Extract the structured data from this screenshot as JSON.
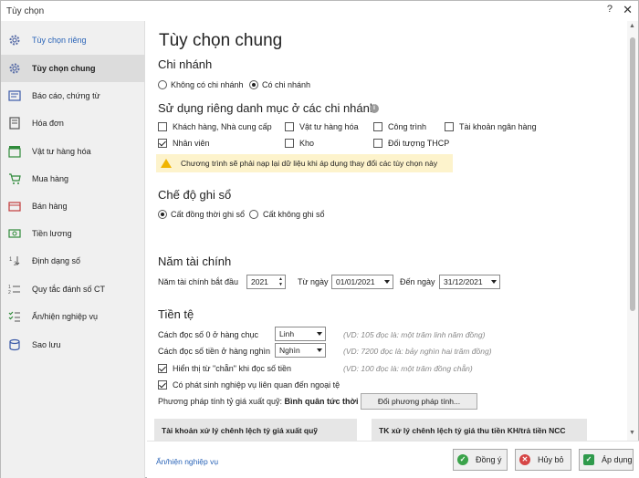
{
  "window": {
    "title": "Tùy chọn",
    "help": "?",
    "close": "✕"
  },
  "sidebar": {
    "items": [
      {
        "label": "Tùy chọn riêng",
        "icon": "gear-icon"
      },
      {
        "label": "Tùy chọn chung",
        "icon": "gear-icon"
      },
      {
        "label": "Báo cáo, chứng từ",
        "icon": "report-icon"
      },
      {
        "label": "Hóa đơn",
        "icon": "invoice-icon"
      },
      {
        "label": "Vật tư hàng hóa",
        "icon": "box-icon"
      },
      {
        "label": "Mua hàng",
        "icon": "cart-icon"
      },
      {
        "label": "Bán hàng",
        "icon": "sale-icon"
      },
      {
        "label": "Tiền lương",
        "icon": "money-icon"
      },
      {
        "label": "Định dạng số",
        "icon": "number-format-icon"
      },
      {
        "label": "Quy tắc đánh số CT",
        "icon": "numbering-icon"
      },
      {
        "label": "Ẩn/hiện nghiệp vụ",
        "icon": "checklist-icon"
      },
      {
        "label": "Sao lưu",
        "icon": "backup-icon"
      }
    ],
    "active_index": 1
  },
  "main": {
    "title": "Tùy chọn chung",
    "branch": {
      "heading": "Chi nhánh",
      "options": [
        "Không có chi nhánh",
        "Có chi nhánh"
      ],
      "selected": 1
    },
    "separate_catalog": {
      "heading": "Sử dụng riêng danh mục ở các chi nhánh",
      "items": [
        {
          "label": "Khách hàng, Nhà cung cấp",
          "checked": false
        },
        {
          "label": "Vật tư hàng hóa",
          "checked": false
        },
        {
          "label": "Công trình",
          "checked": false
        },
        {
          "label": "Tài khoản ngân hàng",
          "checked": false
        },
        {
          "label": "Nhân viên",
          "checked": true
        },
        {
          "label": "Kho",
          "checked": false
        },
        {
          "label": "Đối tượng THCP",
          "checked": false
        }
      ],
      "warning": "Chương trình sẽ phải nạp lại dữ liệu khi áp dụng thay đổi các tùy chọn này"
    },
    "posting_mode": {
      "heading": "Chế độ ghi sổ",
      "options": [
        "Cất đồng thời ghi sổ",
        "Cất không ghi sổ"
      ],
      "selected": 0
    },
    "fiscal_year": {
      "heading": "Năm tài chính",
      "start_label": "Năm tài chính bắt đầu",
      "start_value": "2021",
      "from_label": "Từ ngày",
      "from_value": "01/01/2021",
      "to_label": "Đến ngày",
      "to_value": "31/12/2021"
    },
    "currency": {
      "heading": "Tiền tệ",
      "zero_tens_label": "Cách đọc số 0 ở hàng chục",
      "zero_tens_value": "Linh",
      "zero_tens_hint": "(VD: 105 đọc là: một trăm linh năm đồng)",
      "thousands_label": "Cách đọc số tiền ở hàng nghìn",
      "thousands_value": "Nghìn",
      "thousands_hint": "(VD: 7200 đọc là: bảy nghìn hai trăm đồng)",
      "show_even_label": "Hiển thị từ \"chẵn\" khi đọc số tiền",
      "show_even_checked": true,
      "show_even_hint": "(VD: 100 đọc là: một trăm đồng chẵn)",
      "foreign_label": "Có phát sinh nghiệp vụ liên quan đến ngoại tệ",
      "foreign_checked": true,
      "rate_method_label": "Phương pháp tính tỷ giá xuất quỹ:",
      "rate_method_value": "Bình quân tức thời",
      "change_method_button": "Đổi phương pháp tính..."
    },
    "panels": {
      "left": "Tài khoản xử lý chênh lệch tỷ giá xuất quỹ",
      "right": "TK xử lý chênh lệch tỷ giá thu tiền KH/trả tiền NCC"
    }
  },
  "footer": {
    "link": "Ẩn/hiện nghiệp vụ",
    "ok": "Đồng ý",
    "cancel": "Hủy bỏ",
    "apply": "Áp dụng"
  },
  "colors": {
    "accent": "#2a64b8",
    "warning_bg": "#fdf3cc",
    "warning_icon": "#f0b400",
    "sidebar_bg": "#f0f0f0",
    "ok": "#3aa34a",
    "cancel": "#d64545",
    "apply": "#2f9a4c"
  }
}
